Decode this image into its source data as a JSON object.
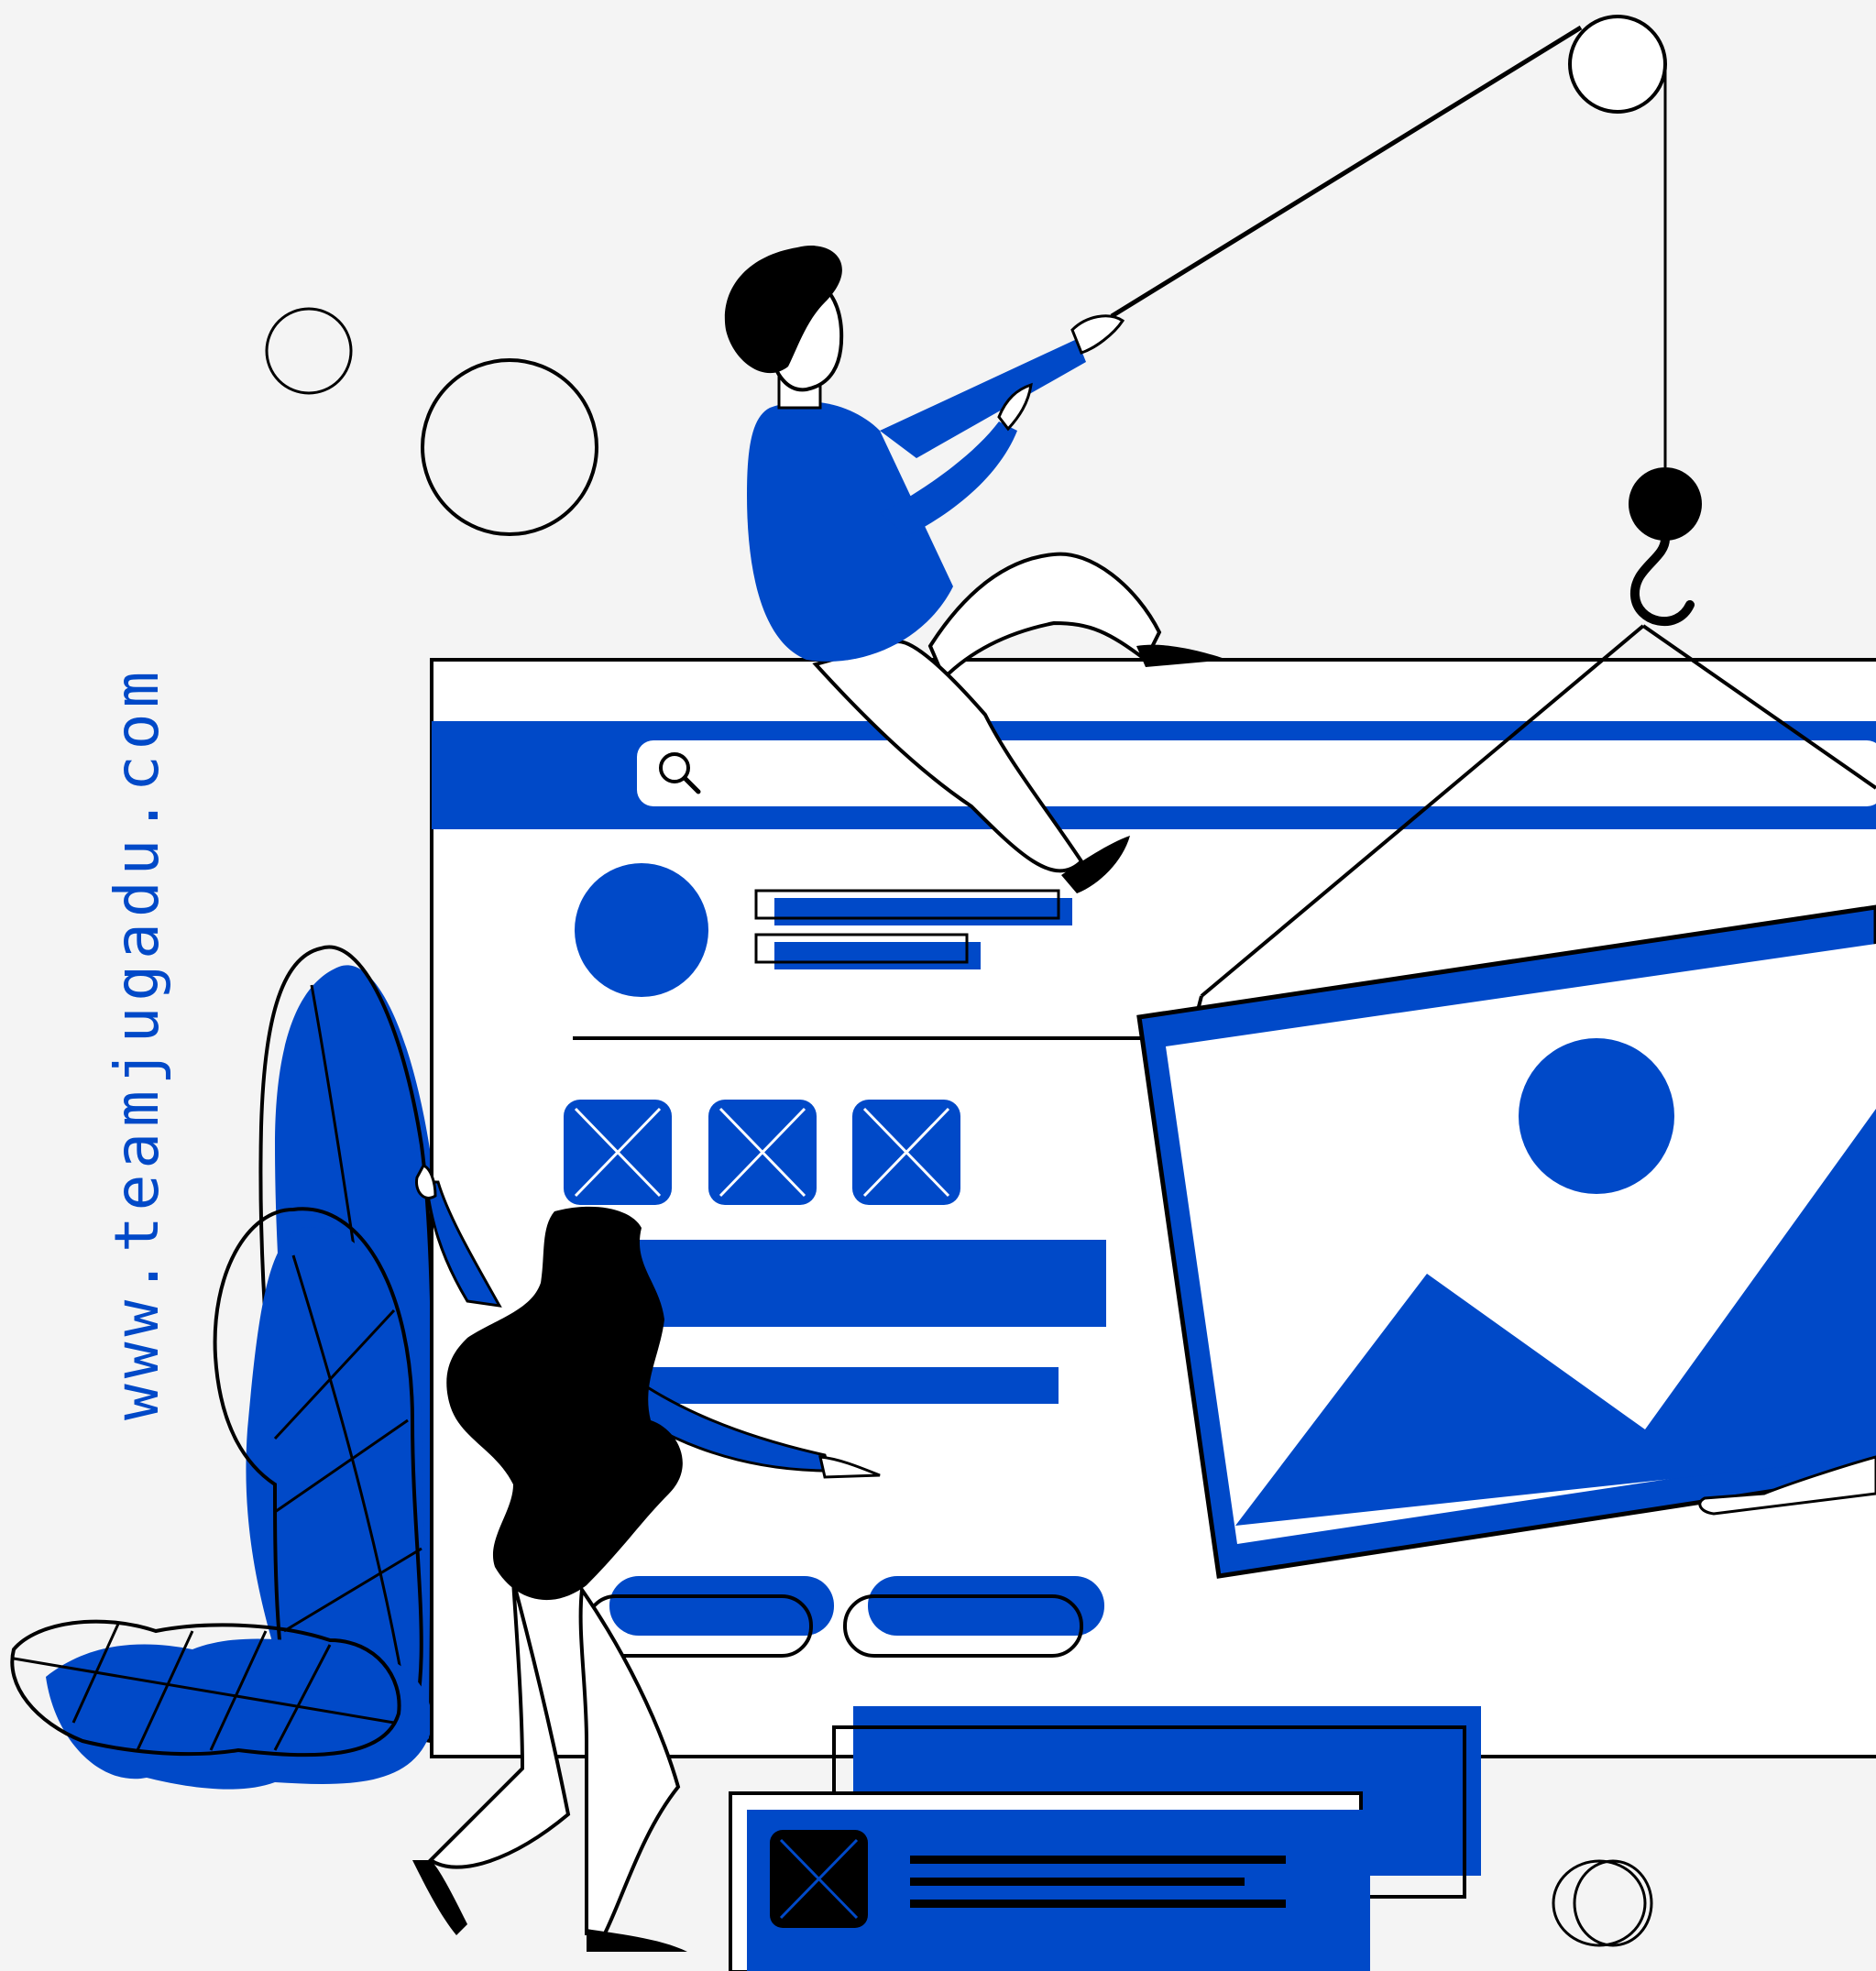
{
  "watermark": {
    "text": "www.teamjugadu.com"
  },
  "colors": {
    "accent": "#0049c8",
    "ink": "#000000",
    "background": "#f4f4f4",
    "paper": "#ffffff"
  },
  "icons": {
    "search": "search-icon",
    "image_placeholder": "x-box-icon",
    "landscape": "image-landscape-icon",
    "hook": "crane-hook-icon"
  }
}
